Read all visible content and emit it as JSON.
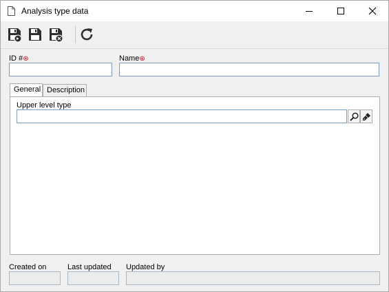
{
  "window": {
    "title": "Analysis type data",
    "icons": {
      "doc": "document-icon",
      "minimize": "minimize-icon",
      "maximize": "maximize-icon",
      "close": "close-icon"
    }
  },
  "toolbar": {
    "buttons": [
      {
        "name": "save-new",
        "icon": "save-and-new-icon"
      },
      {
        "name": "save",
        "icon": "save-icon"
      },
      {
        "name": "save-close",
        "icon": "save-and-close-icon"
      },
      {
        "name": "refresh",
        "icon": "refresh-icon"
      }
    ]
  },
  "form": {
    "id_label": "ID #",
    "name_label": "Name",
    "id_value": "",
    "name_value": "",
    "required_marker": "⊛"
  },
  "tabs": [
    {
      "label": "General",
      "active": true
    },
    {
      "label": "Description",
      "active": false
    }
  ],
  "general": {
    "upper_level_type_label": "Upper level type",
    "upper_level_type_value": ""
  },
  "footer": {
    "created_on_label": "Created on",
    "last_updated_label": "Last updated",
    "updated_by_label": "Updated by",
    "created_on_value": "",
    "last_updated_value": "",
    "updated_by_value": ""
  },
  "colors": {
    "required": "#d0021b",
    "input_border": "#7a9cc0",
    "tab_border": "#adadad"
  }
}
